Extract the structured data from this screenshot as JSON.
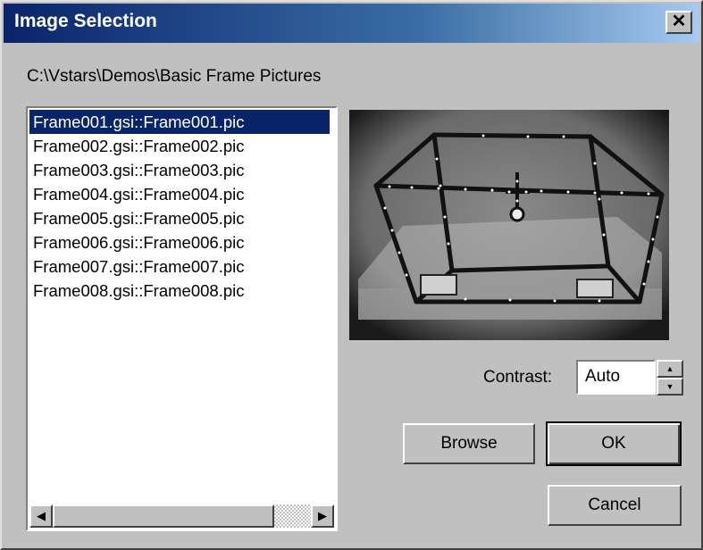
{
  "window": {
    "title": "Image Selection",
    "close_label": "✕"
  },
  "path_label": "C:\\Vstars\\Demos\\Basic Frame Pictures",
  "file_list": {
    "items": [
      "Frame001.gsi::Frame001.pic",
      "Frame002.gsi::Frame002.pic",
      "Frame003.gsi::Frame003.pic",
      "Frame004.gsi::Frame004.pic",
      "Frame005.gsi::Frame005.pic",
      "Frame006.gsi::Frame006.pic",
      "Frame007.gsi::Frame007.pic",
      "Frame008.gsi::Frame008.pic"
    ],
    "selected_index": 0
  },
  "scrollbar": {
    "left_arrow": "◀",
    "right_arrow": "▶"
  },
  "contrast": {
    "label": "Contrast:",
    "value": "Auto",
    "up_arrow": "▲",
    "down_arrow": "▼"
  },
  "buttons": {
    "browse": "Browse",
    "ok": "OK",
    "cancel": "Cancel"
  },
  "colors": {
    "title_bar_start": "#0a246a",
    "title_bar_end": "#a6caf0",
    "selection": "#0a246a",
    "dialog_face": "#c0c0c0"
  }
}
